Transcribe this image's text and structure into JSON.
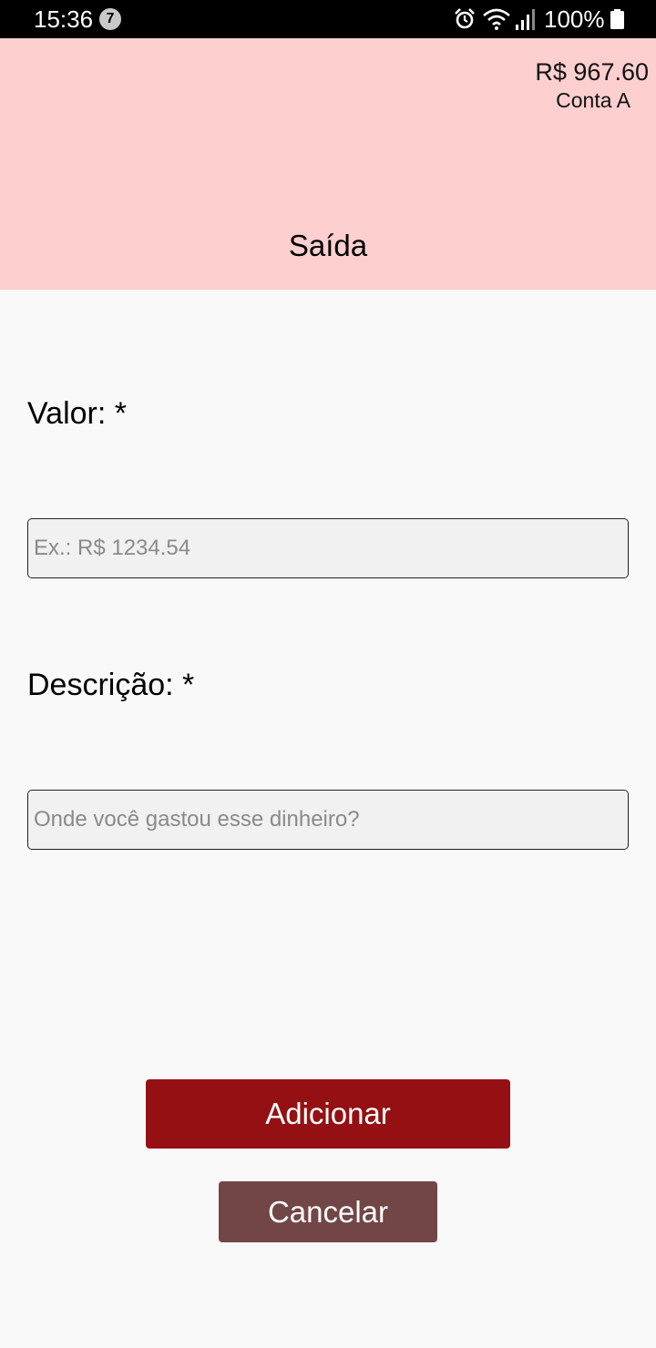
{
  "status_bar": {
    "time": "15:36",
    "notification_count": "7",
    "battery": "100%",
    "icons": [
      "alarm-icon",
      "wifi-icon",
      "signal-icon",
      "battery-icon"
    ]
  },
  "header": {
    "balance": "R$ 967.60",
    "account": "Conta A",
    "title": "Saída",
    "background_color": "#fdcfcf"
  },
  "form": {
    "amount_label": "Valor: *",
    "amount_placeholder": "Ex.: R$ 1234.54",
    "amount_value": "",
    "description_label": "Descrição: *",
    "description_placeholder": "Onde você gastou esse dinheiro?",
    "description_value": ""
  },
  "actions": {
    "add_label": "Adicionar",
    "add_color": "#941013",
    "cancel_label": "Cancelar",
    "cancel_color": "#724646"
  }
}
